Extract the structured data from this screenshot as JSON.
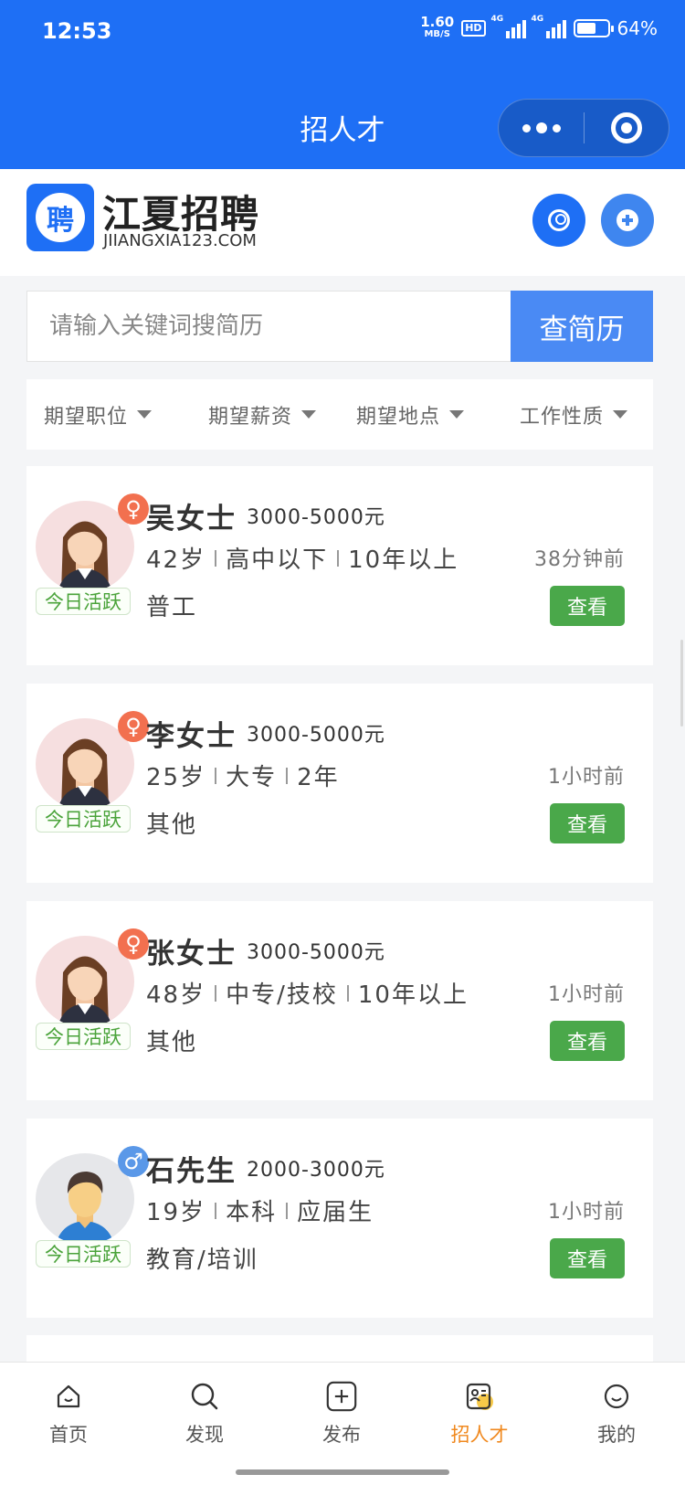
{
  "status_bar": {
    "time": "12:53",
    "net_speed_value": "1.60",
    "net_speed_unit": "MB/S",
    "hd_label": "HD",
    "signal1_label": "4G",
    "signal2_label": "4G",
    "battery_percent_text": "64%",
    "battery_level": 0.64
  },
  "navbar": {
    "title": "招人才",
    "more_icon": "more-dots-icon",
    "close_icon": "target-close-icon"
  },
  "brand": {
    "logo_char": "聘",
    "name": "江夏招聘",
    "url": "JIIANGXIA123.COM",
    "user_icon": "user-icon",
    "add_icon": "plus-icon"
  },
  "search": {
    "placeholder": "请输入关键词搜简历",
    "value": "",
    "button_label": "查简历"
  },
  "filters": [
    {
      "label": "期望职位"
    },
    {
      "label": "期望薪资"
    },
    {
      "label": "期望地点"
    },
    {
      "label": "工作性质"
    }
  ],
  "candidates": [
    {
      "name": "吴女士",
      "gender": "female",
      "gender_symbol": "♀",
      "salary": "3000-5000元",
      "age": "42岁",
      "education": "高中以下",
      "experience": "10年以上",
      "job": "普工",
      "time": "38分钟前",
      "active_tag": "今日活跃",
      "view_label": "查看"
    },
    {
      "name": "李女士",
      "gender": "female",
      "gender_symbol": "♀",
      "salary": "3000-5000元",
      "age": "25岁",
      "education": "大专",
      "experience": "2年",
      "job": "其他",
      "time": "1小时前",
      "active_tag": "今日活跃",
      "view_label": "查看"
    },
    {
      "name": "张女士",
      "gender": "female",
      "gender_symbol": "♀",
      "salary": "3000-5000元",
      "age": "48岁",
      "education": "中专/技校",
      "experience": "10年以上",
      "job": "其他",
      "time": "1小时前",
      "active_tag": "今日活跃",
      "view_label": "查看"
    },
    {
      "name": "石先生",
      "gender": "male",
      "gender_symbol": "♂",
      "salary": "2000-3000元",
      "age": "19岁",
      "education": "本科",
      "experience": "应届生",
      "job": "教育/培训",
      "time": "1小时前",
      "active_tag": "今日活跃",
      "view_label": "查看"
    }
  ],
  "tabbar": [
    {
      "label": "首页",
      "icon": "home-icon",
      "active": false
    },
    {
      "label": "发现",
      "icon": "search-icon",
      "active": false
    },
    {
      "label": "发布",
      "icon": "publish-plus-icon",
      "active": false
    },
    {
      "label": "招人才",
      "icon": "resume-icon",
      "active": true
    },
    {
      "label": "我的",
      "icon": "smile-icon",
      "active": false
    }
  ],
  "colors": {
    "primary_blue": "#1e6ff5",
    "search_button": "#4a8af4",
    "view_button_green": "#4aa84a",
    "active_tag_green": "#4aa33a",
    "female_badge": "#f2704f",
    "male_badge": "#5a98e8",
    "tab_active": "#f0891f"
  }
}
